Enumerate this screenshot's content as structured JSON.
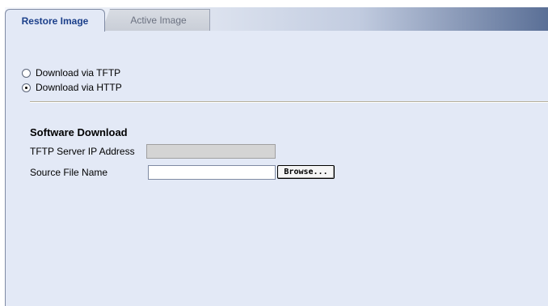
{
  "tabs": [
    {
      "label": "Restore Image",
      "active": true
    },
    {
      "label": "Active Image",
      "active": false
    }
  ],
  "download_method": {
    "options": [
      {
        "label": "Download via TFTP",
        "checked": false
      },
      {
        "label": "Download via HTTP",
        "checked": true
      }
    ]
  },
  "software_download": {
    "title": "Software Download",
    "tftp_server_ip_label": "TFTP Server IP Address",
    "tftp_server_ip_value": "",
    "tftp_server_ip_disabled": true,
    "source_file_label": "Source File Name",
    "source_file_value": "",
    "browse_label": "Browse..."
  },
  "colors": {
    "panel_background": "#e3e9f6",
    "active_tab_text": "#1b3f8a",
    "disabled_field": "#d4d4d4"
  }
}
